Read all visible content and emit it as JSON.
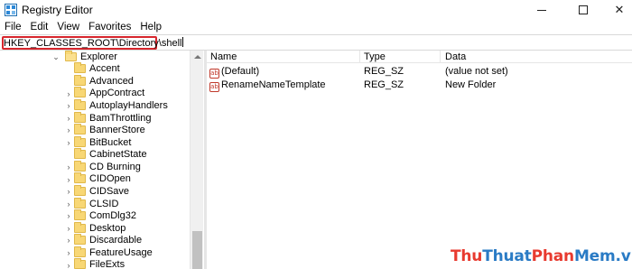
{
  "window": {
    "title": "Registry Editor",
    "minimize": "",
    "maximize": "",
    "close": "✕"
  },
  "menu": [
    "File",
    "Edit",
    "View",
    "Favorites",
    "Help"
  ],
  "address": {
    "path": "HKEY_CLASSES_ROOT\\Directory\\shell"
  },
  "tree": {
    "parent": {
      "label": "Explorer",
      "expanded": true
    },
    "children": [
      {
        "label": "Accent",
        "expandable": false
      },
      {
        "label": "Advanced",
        "expandable": false
      },
      {
        "label": "AppContract",
        "expandable": true
      },
      {
        "label": "AutoplayHandlers",
        "expandable": true
      },
      {
        "label": "BamThrottling",
        "expandable": true
      },
      {
        "label": "BannerStore",
        "expandable": true
      },
      {
        "label": "BitBucket",
        "expandable": true
      },
      {
        "label": "CabinetState",
        "expandable": false
      },
      {
        "label": "CD Burning",
        "expandable": true
      },
      {
        "label": "CIDOpen",
        "expandable": true
      },
      {
        "label": "CIDSave",
        "expandable": true
      },
      {
        "label": "CLSID",
        "expandable": true
      },
      {
        "label": "ComDlg32",
        "expandable": true
      },
      {
        "label": "Desktop",
        "expandable": true
      },
      {
        "label": "Discardable",
        "expandable": true
      },
      {
        "label": "FeatureUsage",
        "expandable": true
      },
      {
        "label": "FileExts",
        "expandable": true
      }
    ]
  },
  "values": {
    "columns": [
      "Name",
      "Type",
      "Data"
    ],
    "rows": [
      {
        "name": "(Default)",
        "type": "REG_SZ",
        "data": "(value not set)"
      },
      {
        "name": "RenameNameTemplate",
        "type": "REG_SZ",
        "data": "New Folder"
      }
    ]
  },
  "watermark": {
    "parts": [
      {
        "text": "Thu",
        "color": "#e83a2f"
      },
      {
        "text": "Thuat",
        "color": "#2a7bc5"
      },
      {
        "text": "Phan",
        "color": "#e83a2f"
      },
      {
        "text": "Mem",
        "color": "#2a7bc5"
      },
      {
        "text": ".vn",
        "color": "#2a7bc5"
      }
    ]
  },
  "icons": {
    "app": "registry-editor-icon",
    "folder": "folder-icon",
    "string_value": "string-value-icon"
  }
}
